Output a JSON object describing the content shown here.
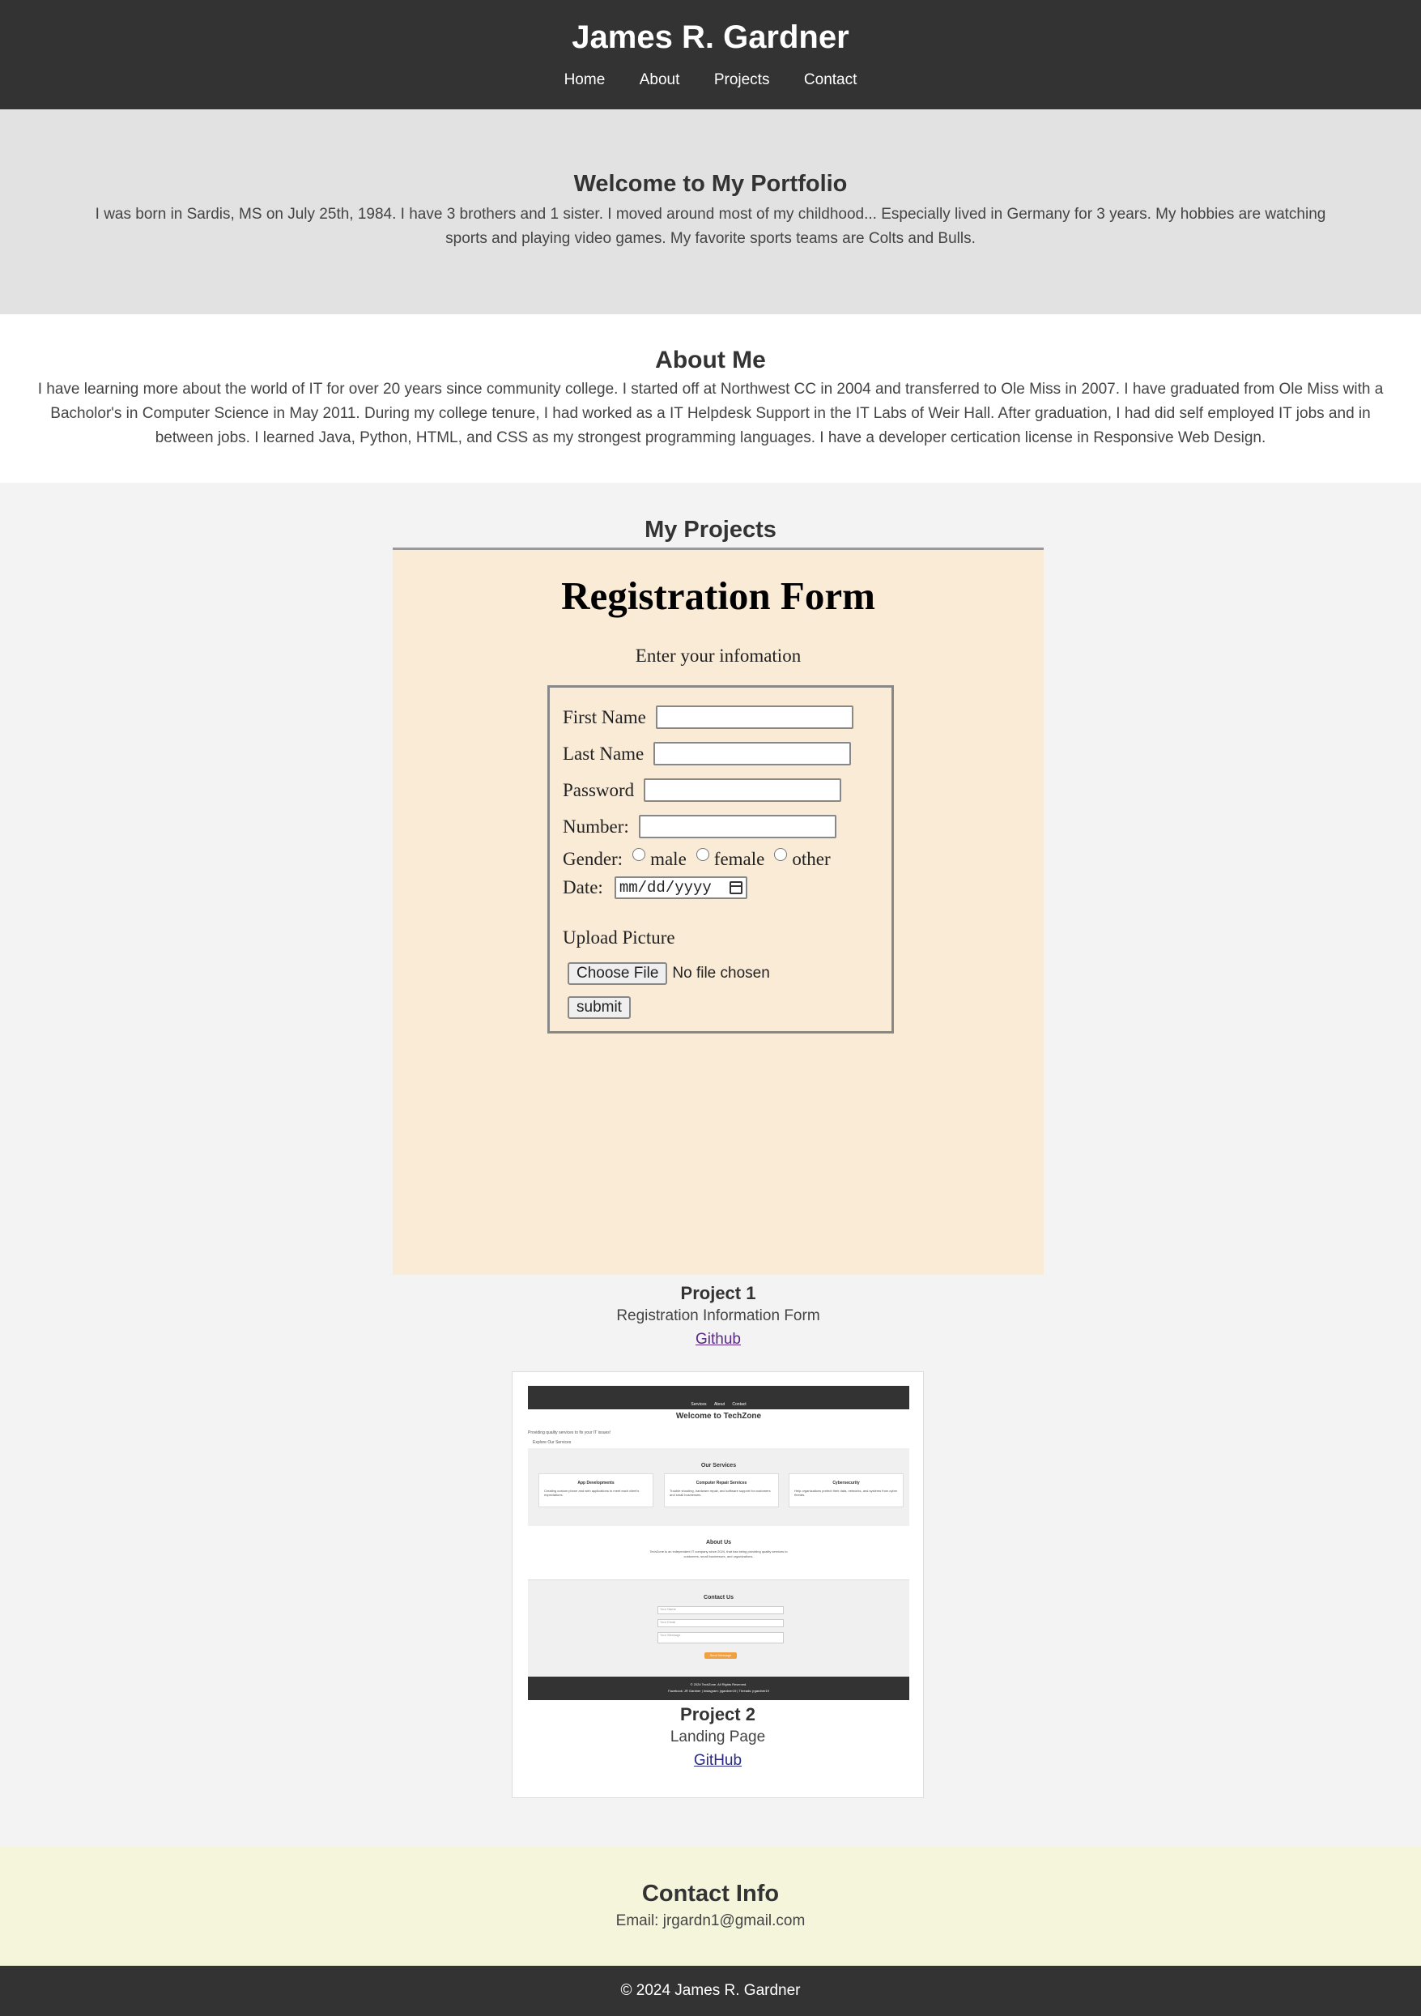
{
  "header": {
    "title": "James R. Gardner",
    "nav": [
      "Home",
      "About",
      "Projects",
      "Contact"
    ]
  },
  "hero": {
    "title": "Welcome to My Portfolio",
    "text": "I was born in Sardis, MS on July 25th, 1984. I have 3 brothers and 1 sister. I moved around most of my childhood... Especially lived in Germany for 3 years. My hobbies are watching sports and playing video games. My favorite sports teams are Colts and Bulls."
  },
  "about": {
    "title": "About Me",
    "text": "I have learning more about the world of IT for over 20 years since community college. I started off at Northwest CC in 2004 and transferred to Ole Miss in 2007. I have graduated from Ole Miss with a Bacholor's in Computer Science in May 2011. During my college tenure, I had worked as a IT Helpdesk Support in the IT Labs of Weir Hall. After graduation, I had did self employed IT jobs and in between jobs. I learned Java, Python, HTML, and CSS as my strongest programming languages. I have a developer certication license in Responsive Web Design."
  },
  "projects": {
    "title": "My Projects",
    "project1": {
      "screenshot": {
        "title": "Registration Form",
        "subtitle": "Enter your infomation",
        "first_name": "First Name",
        "last_name": "Last Name",
        "password": "Password",
        "number": "Number:",
        "gender": "Gender:",
        "gender_options": [
          "male",
          "female",
          "other"
        ],
        "date": "Date:",
        "date_placeholder": "mm/dd/yyyy",
        "upload": "Upload Picture",
        "choose_file": "Choose File",
        "no_file": "No file chosen",
        "submit": "submit"
      },
      "name": "Project 1",
      "description": "Registration Information Form",
      "link": "Github"
    },
    "project2": {
      "screenshot": {
        "nav": [
          "Services",
          "About",
          "Contact"
        ],
        "title": "Welcome to TechZone",
        "tagline": "Providing quality services to fix your IT issues!",
        "explore": "Explore Our Services",
        "services_title": "Our Services",
        "services": [
          {
            "title": "App Developments",
            "text": "Creating custom phone and web applications to meet each client's expectations."
          },
          {
            "title": "Computer Repair Services",
            "text": "Trouble shooting, hardware repair, and software support for customers and small businesses."
          },
          {
            "title": "Cybersecurity",
            "text": "Help organizations protect their data, networks, and systems from cyber threats."
          }
        ],
        "about_title": "About Us",
        "about_text": "TechZone is an independent IT company since 2024, that has being providing quality services to customers, small businesses, and organizations.",
        "contact_title": "Contact Us",
        "fields": [
          "Your Name",
          "Your Email",
          "Your Message"
        ],
        "send": "Send Message",
        "footer_copy": "© 2024 TechZone. All Rights Reserved.",
        "footer_links": "Facebook: JR Gardner  |  Instagram: jrgardner19  |  Threads: jrgardner19"
      },
      "name": "Project 2",
      "description": "Landing Page",
      "link": "GitHub"
    }
  },
  "contact": {
    "title": "Contact Info",
    "email": "Email: jrgardn1@gmail.com"
  },
  "footer": {
    "text": "© 2024 James R. Gardner"
  },
  "colors": {
    "header_bg": "#333333",
    "hero_bg": "#e2e2e2",
    "projects_bg": "#f3f3f3",
    "form_bg": "#faebd7",
    "contact_bg": "#f5f5dc",
    "visited_link": "#5b2a86",
    "link": "#2b2b85"
  }
}
